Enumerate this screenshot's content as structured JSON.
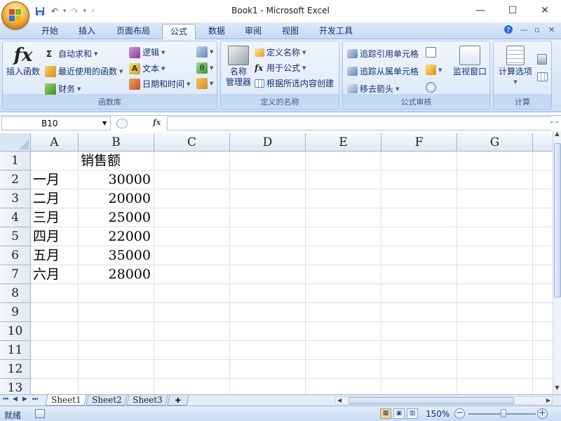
{
  "window": {
    "title": "Book1 - Microsoft Excel",
    "minimize": "—",
    "maximize": "☐",
    "close": "✕"
  },
  "tabs": [
    "开始",
    "插入",
    "页面布局",
    "公式",
    "数据",
    "审阅",
    "视图",
    "开发工具"
  ],
  "active_tab": "公式",
  "ribbon": {
    "function_library": {
      "title": "函数库",
      "insert_function": "插入函数",
      "autosum": "自动求和",
      "recent": "最近使用的函数",
      "financial": "财务",
      "logical": "逻辑",
      "text": "文本",
      "datetime": "日期和时间"
    },
    "defined_names": {
      "title": "定义的名称",
      "name_manager_1": "名称",
      "name_manager_2": "管理器",
      "define_name": "定义名称",
      "use_in_formula": "用于公式",
      "create_from_selection": "根据所选内容创建"
    },
    "formula_auditing": {
      "title": "公式审核",
      "trace_precedents": "追踪引用单元格",
      "trace_dependents": "追踪从属单元格",
      "remove_arrows": "移去箭头",
      "watch_window": "监视窗口"
    },
    "calculation": {
      "title": "计算",
      "calc_options": "计算选项"
    }
  },
  "formula_bar": {
    "name_box": "B10",
    "fx": "fx",
    "formula": ""
  },
  "columns": [
    "A",
    "B",
    "C",
    "D",
    "E",
    "F",
    "G"
  ],
  "rows": [
    "1",
    "2",
    "3",
    "4",
    "5",
    "6",
    "7",
    "8",
    "9",
    "10",
    "11",
    "12",
    "13"
  ],
  "cells": {
    "B1": "销售额",
    "A2": "一月",
    "B2": "30000",
    "A3": "二月",
    "B3": "20000",
    "A4": "三月",
    "B4": "25000",
    "A5": "四月",
    "B5": "22000",
    "A6": "五月",
    "B6": "35000",
    "A7": "六月",
    "B7": "28000"
  },
  "sheets": [
    "Sheet1",
    "Sheet2",
    "Sheet3"
  ],
  "active_sheet": "Sheet1",
  "status": {
    "mode": "就绪",
    "zoom": "150%"
  }
}
